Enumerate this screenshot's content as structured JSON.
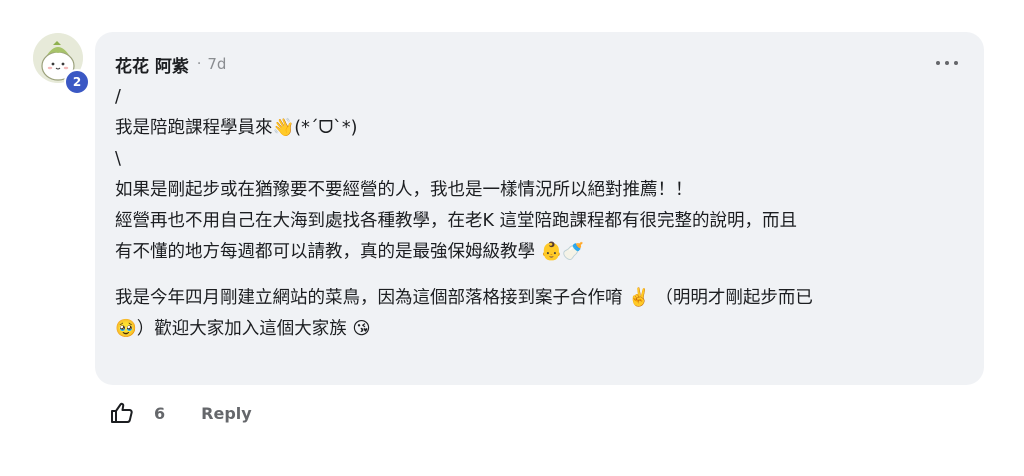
{
  "avatar": {
    "badge": "2"
  },
  "comment": {
    "author": "花花 阿紫",
    "separator": "·",
    "time": "7d",
    "lines": [
      "/",
      "我是陪跑課程學員來👋(*ˊᗜˋ*)",
      "\\",
      "如果是剛起步或在猶豫要不要經營的人，我也是一樣情況所以絕對推薦！！",
      "經營再也不用自己在大海到處找各種教學，在老K 這堂陪跑課程都有很完整的說明，而且",
      "有不懂的地方每週都可以請教，真的是最強保姆級教學 👶🍼",
      "我是今年四月剛建立網站的菜鳥，因為這個部落格接到案子合作唷 ✌️ （明明才剛起步而已",
      "🥹）歡迎大家加入這個大家族 😘"
    ]
  },
  "actions": {
    "like_count": "6",
    "reply_label": "Reply"
  },
  "icons": {
    "like": "thumbs-up-icon",
    "more": "more-horizontal-icon"
  },
  "colors": {
    "bubble_bg": "#f0f2f5",
    "badge_bg": "#3b58c4",
    "muted_text": "#65676b"
  }
}
